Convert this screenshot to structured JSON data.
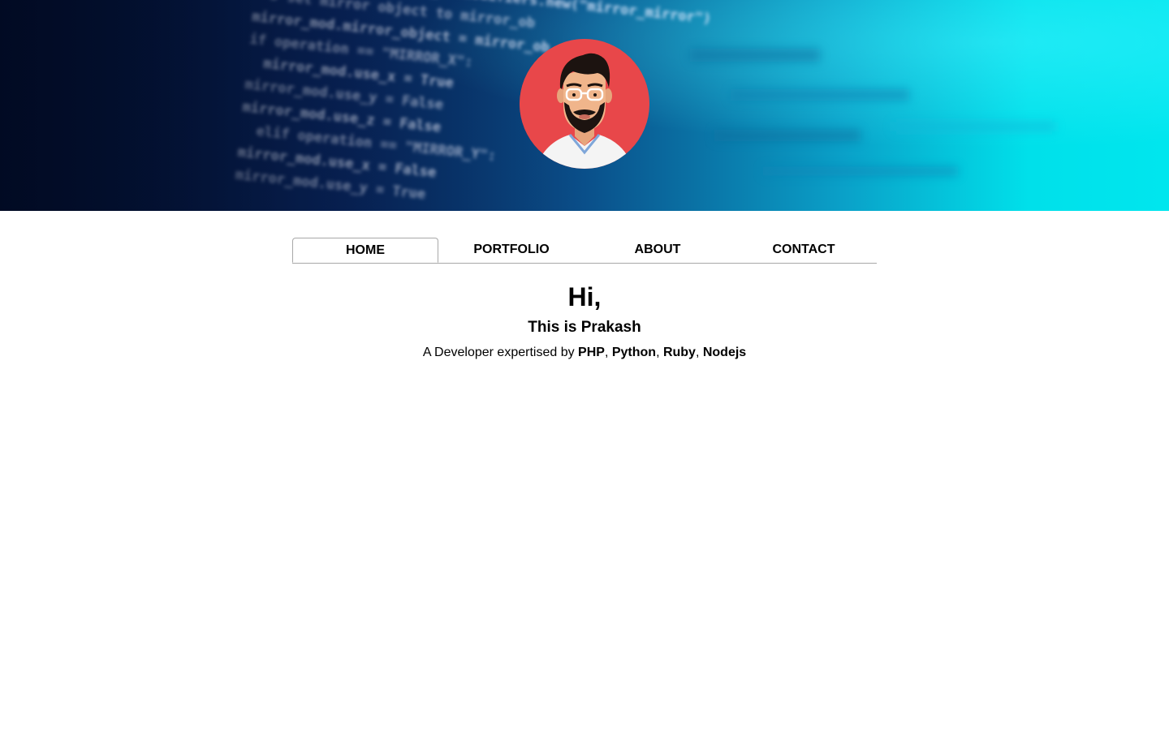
{
  "nav": {
    "items": [
      {
        "label": "HOME",
        "active": true
      },
      {
        "label": "PORTFOLIO",
        "active": false
      },
      {
        "label": "ABOUT",
        "active": false
      },
      {
        "label": "CONTACT",
        "active": false
      }
    ]
  },
  "hero": {
    "greeting": "Hi,",
    "name_line": "This is Prakash",
    "intro_prefix": "A Developer expertised by",
    "skills": [
      "PHP",
      "Python",
      "Ruby",
      "Nodejs"
    ]
  },
  "banner": {
    "code_lines": [
      "mirror_mod = modifier_ob.modifiers.new(\"mirror_mirror\")",
      "# set mirror object to mirror_ob",
      "mirror_mod.mirror_object = mirror_ob",
      "if operation == \"MIRROR_X\":",
      "mirror_mod.use_x = True",
      "mirror_mod.use_y = False",
      "mirror_mod.use_z = False",
      "elif operation == \"MIRROR_Y\":",
      "mirror_mod.use_x = False",
      "mirror_mod.use_y = True"
    ]
  },
  "colors": {
    "avatar_bg": "#e8474a",
    "tab_border": "#a8a8a8"
  }
}
